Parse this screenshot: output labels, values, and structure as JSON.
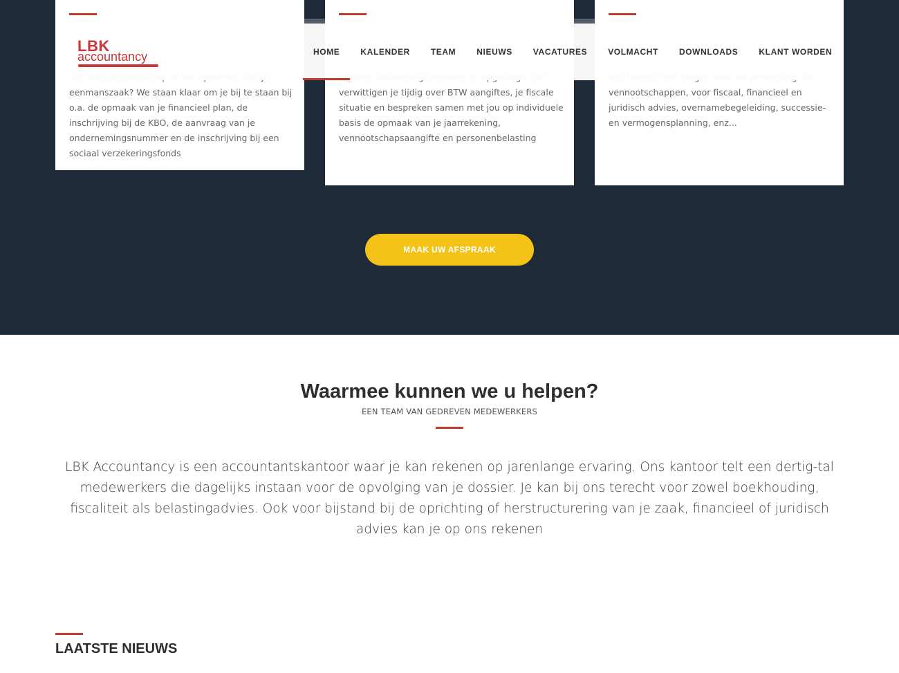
{
  "header": {
    "logo_top": "LBK",
    "logo_bottom": "accountancy",
    "nav": [
      {
        "label": "HOME",
        "active": true
      },
      {
        "label": "KALENDER"
      },
      {
        "label": "TEAM"
      },
      {
        "label": "NIEUWS"
      },
      {
        "label": "VACATURES"
      },
      {
        "label": "VOLMACHT"
      },
      {
        "label": "DOWNLOADS"
      },
      {
        "label": "KLANT WORDEN"
      }
    ]
  },
  "services": [
    {
      "text": "van een vennootschap of het opstarten van je eenmanszaak? We staan klaar om je bij te staan bij o.a. de opmaak van je financieel plan, de inschrijving bij de KBO, de aanvraag van je ondernemingsnummer en de inschrijving bij een sociaal verzekeringsfonds"
    },
    {
      "text": "worden nauwkeurig verwerkt en opgevolgd. We verwittigen je tijdig over BTW aangiftes, je fiscale situatie en bespreken samen met jou op individuele basis de opmaak van je jaarrekening, vennootschapsaangifte en personenbelasting"
    },
    {
      "text": "ons terecht met vragen over de verwerking van vennootschappen, voor fiscaal, financieel en juridisch advies, overnamebegeleiding, successie- en vermogensplanning, enz..."
    }
  ],
  "cta_label": "MAAK UW AFSPRAAK",
  "section": {
    "title": "Waarmee kunnen we u helpen?",
    "subtitle": "EEN TEAM VAN GEDREVEN MEDEWERKERS",
    "intro": "LBK Accountancy is een accountantskantoor waar je kan rekenen op jarenlange ervaring. Ons kantoor telt een dertig-tal medewerkers die dagelijks instaan voor de opvolging van je dossier. Je kan bij ons terecht voor zowel boekhouding, fiscaliteit als belastingadvies. Ook voor bijstand bij de oprichting of herstructurering van je zaak, financieel of juridisch advies kan je op ons rekenen"
  },
  "news": {
    "title": "LAATSTE NIEUWS"
  },
  "colors": {
    "accent_red": "#c0392b",
    "dark_bg": "#1e2a38",
    "cta_yellow": "#f5c218"
  }
}
